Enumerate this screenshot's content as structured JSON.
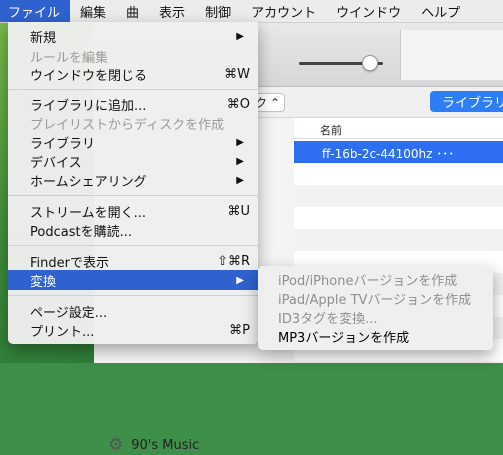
{
  "menubar": {
    "items": [
      "ファイル",
      "編集",
      "曲",
      "表示",
      "制御",
      "アカウント",
      "ウインドウ",
      "ヘルプ"
    ]
  },
  "window": {
    "toolbar": {
      "volume_level": 0.85
    },
    "subbar": {
      "select_fragment": "ク",
      "library_button": "ライブラリ"
    },
    "table": {
      "column_header": "名前",
      "selected_row": "ff-16b-2c-44100hz ･･･"
    },
    "sidebar": {
      "visible_item": "90's Music",
      "visible_item_icon": "gear-icon"
    }
  },
  "file_menu": {
    "new": "新規",
    "edit_rule": "ルールを編集",
    "close_window": "ウインドウを閉じる",
    "close_window_shortcut": "⌘W",
    "add_to_library": "ライブラリに追加...",
    "add_to_library_shortcut": "⌘O",
    "burn_playlist": "プレイリストからディスクを作成",
    "library": "ライブラリ",
    "devices": "デバイス",
    "home_sharing": "ホームシェアリング",
    "open_stream": "ストリームを開く...",
    "open_stream_shortcut": "⌘U",
    "subscribe_podcast": "Podcastを購読...",
    "show_in_finder": "Finderで表示",
    "show_in_finder_shortcut": "⇧⌘R",
    "convert": "変換",
    "page_setup": "ページ設定...",
    "print": "プリント...",
    "print_shortcut": "⌘P",
    "submenu_arrow": "▶"
  },
  "convert_submenu": {
    "items": [
      {
        "label": "iPod/iPhoneバージョンを作成",
        "enabled": false
      },
      {
        "label": "iPad/Apple TVバージョンを作成",
        "enabled": false
      },
      {
        "label": "ID3タグを変換...",
        "enabled": false
      },
      {
        "label": "MP3バージョンを作成",
        "enabled": true
      }
    ]
  }
}
